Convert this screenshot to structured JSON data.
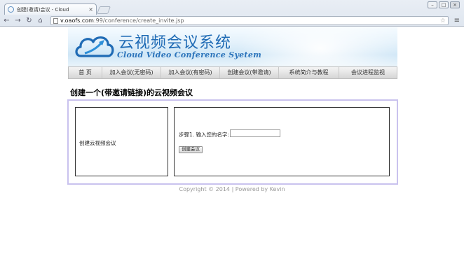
{
  "browser": {
    "tab_title": "创建(邀请)会议 - Cloud",
    "url_host": "v.oaofs.com",
    "url_path": ":99/conference/create_invite.jsp"
  },
  "banner": {
    "title_cn": "云视频会议系统",
    "title_en": "Cloud Video Conference Syetem"
  },
  "nav": {
    "items": [
      {
        "label": "首 页"
      },
      {
        "label": "加入会议(无密码)"
      },
      {
        "label": "加入会议(有密码)"
      },
      {
        "label": "创建会议(带邀请)"
      },
      {
        "label": "系统简介与教程"
      },
      {
        "label": "会议进程监视"
      }
    ]
  },
  "page": {
    "heading": "创建一个(带邀请链接)的云视频会议",
    "left_panel_text": "创建云视频会议",
    "step_label": "步骤1. 输入您的名字:",
    "name_input_value": "",
    "create_button": "创建会议"
  },
  "footer": {
    "text": "Copyright © 2014  |  Powered by Kevin"
  },
  "colors": {
    "brand_blue": "#1f6bb5",
    "container_border": "#c9c2ee",
    "footer_gray": "#999999"
  }
}
